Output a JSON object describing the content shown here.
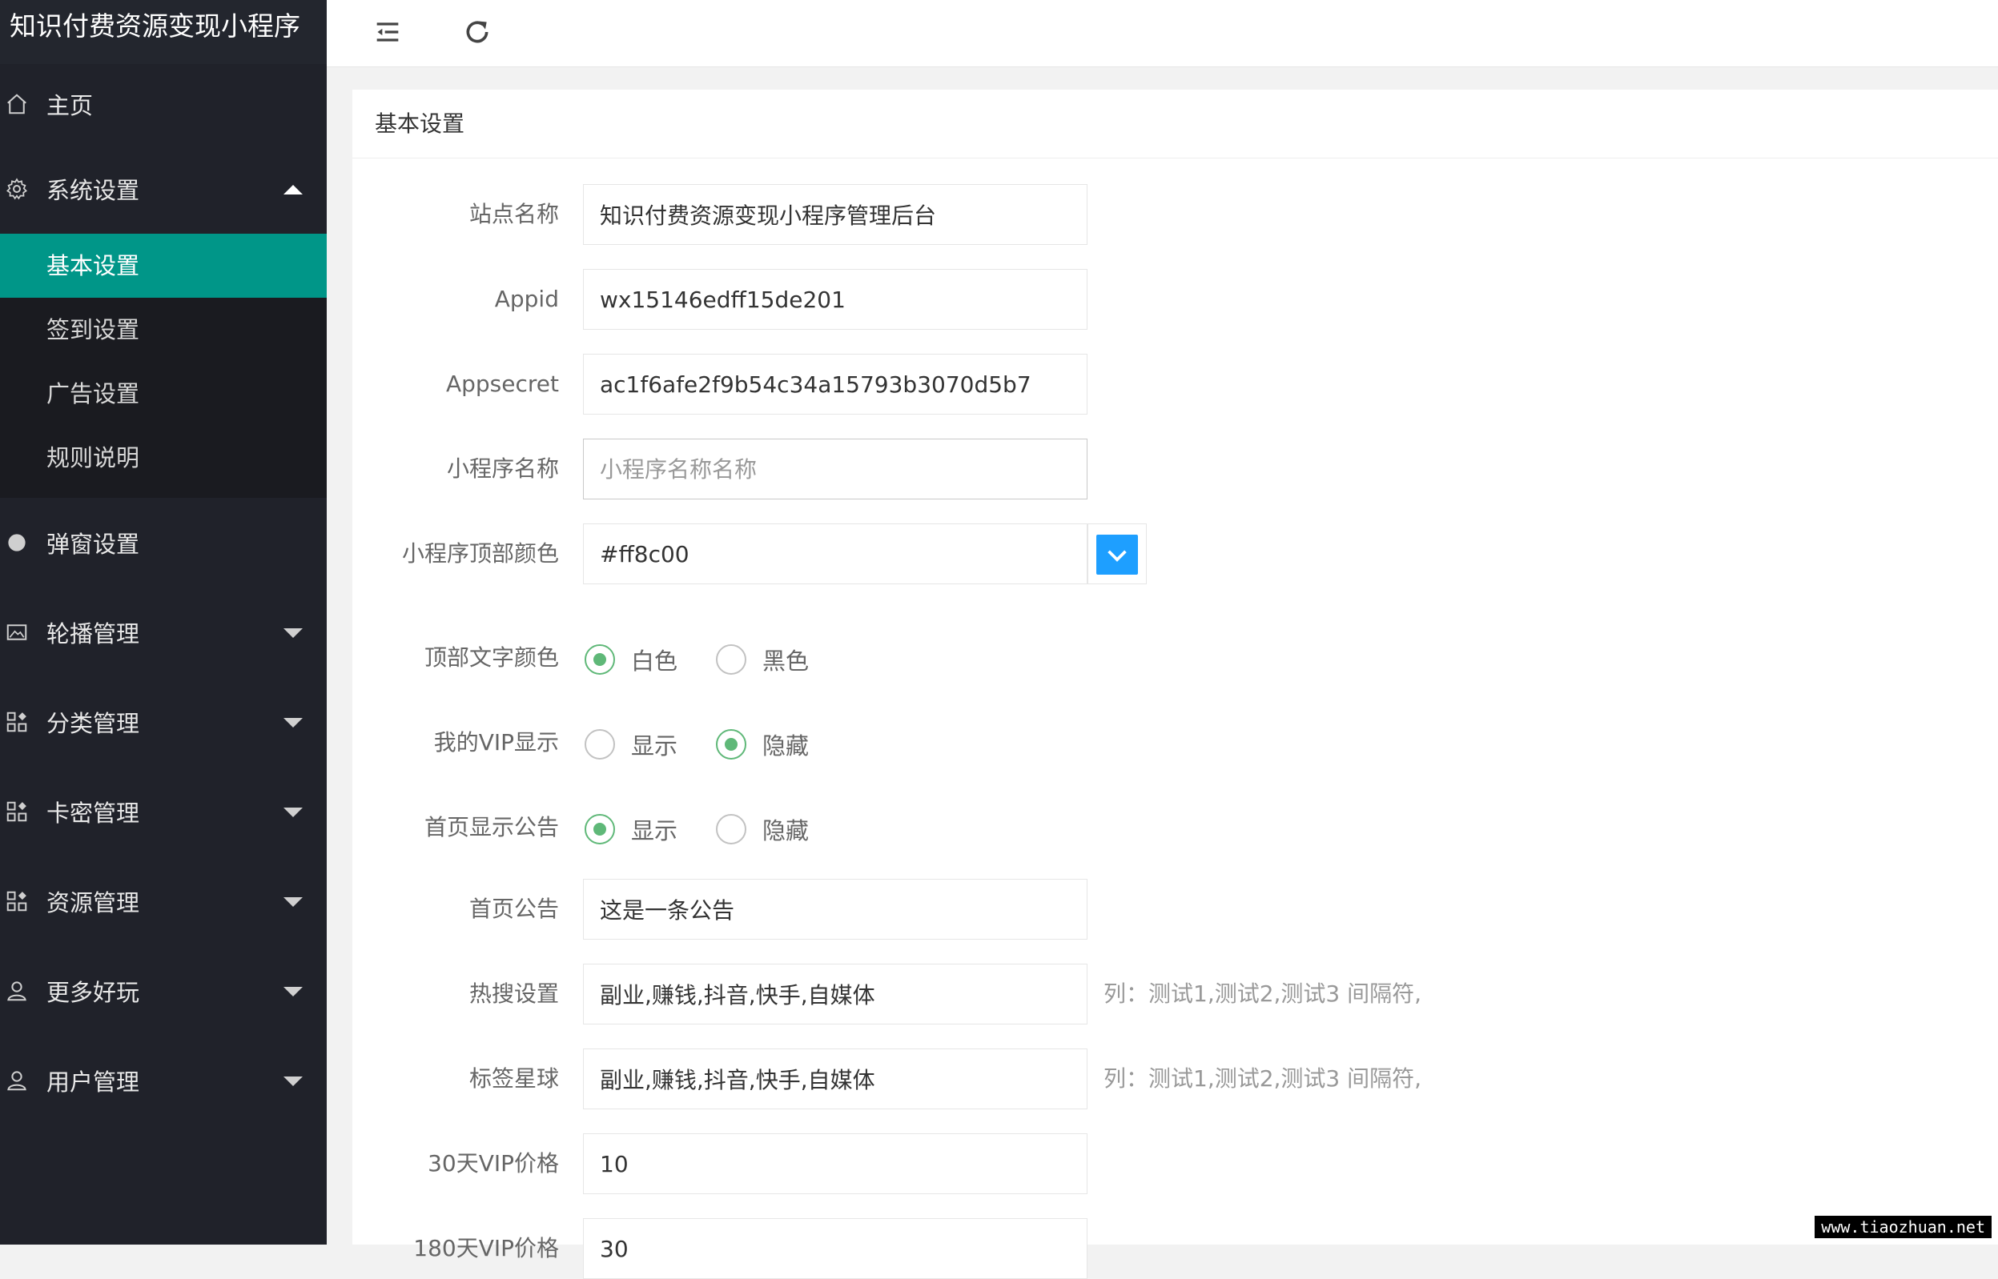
{
  "app": {
    "title": "知识付费资源变现小程序"
  },
  "sidebar": {
    "home": "主页",
    "system_settings": {
      "label": "系统设置",
      "children": [
        "基本设置",
        "签到设置",
        "广告设置",
        "规则说明"
      ]
    },
    "items": [
      "弹窗设置",
      "轮播管理",
      "分类管理",
      "卡密管理",
      "资源管理",
      "更多好玩",
      "用户管理"
    ]
  },
  "card": {
    "title": "基本设置"
  },
  "form": {
    "site_name": {
      "label": "站点名称",
      "value": "知识付费资源变现小程序管理后台"
    },
    "appid": {
      "label": "Appid",
      "value": "wx15146edff15de201"
    },
    "appsecret": {
      "label": "Appsecret",
      "value": "ac1f6afe2f9b54c34a15793b3070d5b7"
    },
    "mini_name": {
      "label": "小程序名称",
      "value": "",
      "placeholder": "小程序名称名称"
    },
    "top_color": {
      "label": "小程序顶部颜色",
      "value": "#ff8c00",
      "picker_color": "#1e9fff"
    },
    "top_text_color": {
      "label": "顶部文字颜色",
      "options": [
        "白色",
        "黑色"
      ],
      "selected": "白色"
    },
    "my_vip": {
      "label": "我的VIP显示",
      "options": [
        "显示",
        "隐藏"
      ],
      "selected": "隐藏"
    },
    "home_notice_show": {
      "label": "首页显示公告",
      "options": [
        "显示",
        "隐藏"
      ],
      "selected": "显示"
    },
    "home_notice": {
      "label": "首页公告",
      "value": "这是一条公告"
    },
    "hot_search": {
      "label": "热搜设置",
      "value": "副业,赚钱,抖音,快手,自媒体",
      "hint": "列：测试1,测试2,测试3 间隔符,"
    },
    "tag_planet": {
      "label": "标签星球",
      "value": "副业,赚钱,抖音,快手,自媒体",
      "hint": "列：测试1,测试2,测试3 间隔符,"
    },
    "vip30": {
      "label": "30天VIP价格",
      "value": "10"
    },
    "vip180": {
      "label": "180天VIP价格",
      "value": "30"
    }
  },
  "watermark": "www.tiaozhuan.net",
  "colors": {
    "sidebar": "#20222a",
    "active": "#009688",
    "radio": "#5fb878",
    "picker": "#1e9fff"
  }
}
